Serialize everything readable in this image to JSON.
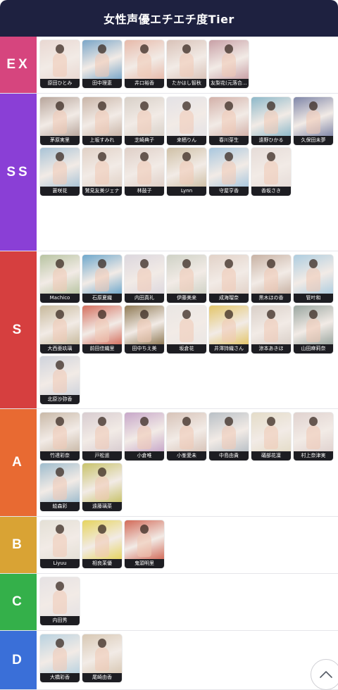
{
  "header": {
    "title": "女性声優エチエチ度Tier"
  },
  "tiers": [
    {
      "label": "EX",
      "color": "#d6457e",
      "items": [
        {
          "name": "原田ひとみ",
          "tone": "#e9d8d2"
        },
        {
          "name": "田中理恵",
          "tone": "#7aa6c8"
        },
        {
          "name": "井口裕香",
          "tone": "#e7b9a9"
        },
        {
          "name": "たかはし智秋",
          "tone": "#d9c2b8"
        },
        {
          "name": "友梨花(元落合…",
          "tone": "#c8a0a6"
        }
      ]
    },
    {
      "label": "SS",
      "color": "#8a3fd6",
      "items": [
        {
          "name": "茅原実里",
          "tone": "#b8a69c"
        },
        {
          "name": "上坂すみれ",
          "tone": "#c9b5a8"
        },
        {
          "name": "芝崎典子",
          "tone": "#d8d0c8"
        },
        {
          "name": "来栖りん",
          "tone": "#e4e2e6"
        },
        {
          "name": "春川芽生",
          "tone": "#d3b1a9"
        },
        {
          "name": "遠野ひかる",
          "tone": "#8db8c9"
        },
        {
          "name": "久保田未夢",
          "tone": "#7f86a8"
        },
        {
          "name": "蒼咲花",
          "tone": "#a9c3d6"
        },
        {
          "name": "鷲見友美ジェナ",
          "tone": "#e1d1c6"
        },
        {
          "name": "林鼓子",
          "tone": "#dfcfc7"
        },
        {
          "name": "Lynn",
          "tone": "#cfc0a6"
        },
        {
          "name": "守屋亨香",
          "tone": "#a9c7de"
        },
        {
          "name": "香坂さき",
          "tone": "#e6dcd8"
        }
      ]
    },
    {
      "label": "S",
      "color": "#d63f3f",
      "items": [
        {
          "name": "Machico",
          "tone": "#b8c4a2"
        },
        {
          "name": "石原夏織",
          "tone": "#6fa8cc"
        },
        {
          "name": "内田真礼",
          "tone": "#dcd7de"
        },
        {
          "name": "伊藤美来",
          "tone": "#cfd2c6"
        },
        {
          "name": "成海瑠奈",
          "tone": "#e2d2c8"
        },
        {
          "name": "黒木ほの香",
          "tone": "#c8b2a4"
        },
        {
          "name": "管叶和",
          "tone": "#aecde0"
        },
        {
          "name": "大西亜玖璃",
          "tone": "#c7b99c"
        },
        {
          "name": "前田佳織里",
          "tone": "#d46f5e"
        },
        {
          "name": "田中ちえ美",
          "tone": "#8f7a55"
        },
        {
          "name": "坂倉花",
          "tone": "#eae6e4"
        },
        {
          "name": "井澤詩織さん",
          "tone": "#e3c56a"
        },
        {
          "name": "涼本あきほ",
          "tone": "#d9cfc8"
        },
        {
          "name": "山田麻莉奈",
          "tone": "#9aa6a0"
        },
        {
          "name": "北原沙弥香",
          "tone": "#cfd3dc"
        }
      ]
    },
    {
      "label": "A",
      "color": "#e86a32",
      "items": [
        {
          "name": "竹達彩奈",
          "tone": "#c9b9a8"
        },
        {
          "name": "戸松遥",
          "tone": "#d8ccd0"
        },
        {
          "name": "小倉唯",
          "tone": "#c7a7c9"
        },
        {
          "name": "小峯愛未",
          "tone": "#d7c3b8"
        },
        {
          "name": "中島由貴",
          "tone": "#b9c0c6"
        },
        {
          "name": "礒部花凜",
          "tone": "#e4dcc8"
        },
        {
          "name": "村上奈津実",
          "tone": "#e0d2cf"
        },
        {
          "name": "絵森彩",
          "tone": "#9fbccd"
        },
        {
          "name": "遠藤璃菜",
          "tone": "#c8c26a"
        }
      ]
    },
    {
      "label": "B",
      "color": "#d9a334",
      "items": [
        {
          "name": "Liyuu",
          "tone": "#e4e0d6"
        },
        {
          "name": "相良茉優",
          "tone": "#e6d45e"
        },
        {
          "name": "鬼頭明里",
          "tone": "#d26a58"
        }
      ]
    },
    {
      "label": "C",
      "color": "#34b04a",
      "items": [
        {
          "name": "内田秀",
          "tone": "#e6e2e4"
        }
      ]
    },
    {
      "label": "D",
      "color": "#3a6fd8",
      "items": [
        {
          "name": "大橋彩香",
          "tone": "#b9d2e0"
        },
        {
          "name": "尾崎由香",
          "tone": "#d8c8b4"
        }
      ]
    }
  ],
  "icons": {
    "scroll_top": "chevron-up-icon"
  }
}
